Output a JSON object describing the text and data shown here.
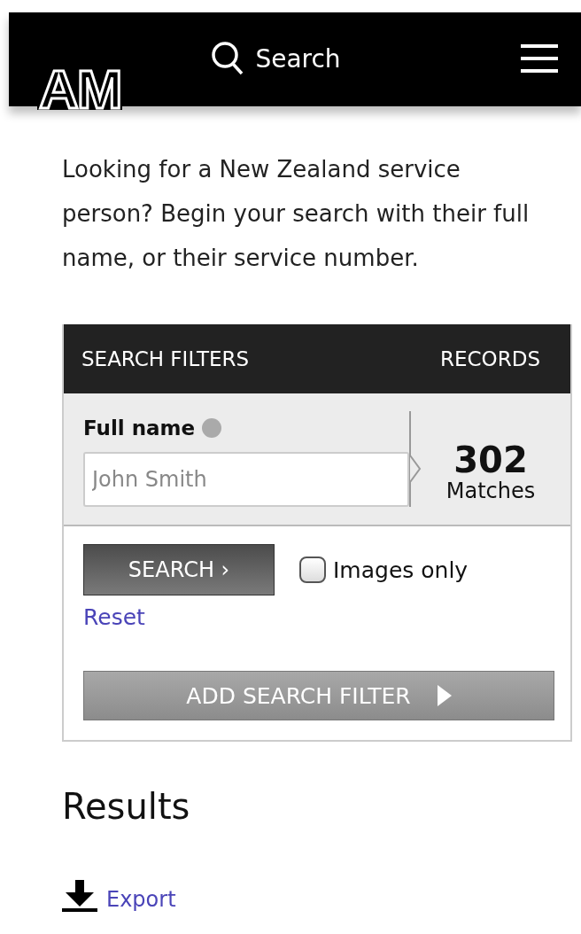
{
  "header": {
    "logo": "AM",
    "search_label": "Search"
  },
  "intro": "Looking for a New Zealand service person? Begin your search with their full name, or their service number.",
  "panel": {
    "title": "SEARCH FILTERS",
    "records_label": "RECORDS",
    "field": {
      "label": "Full name",
      "placeholder": "John Smith"
    },
    "count": "302",
    "count_label": "Matches",
    "search_button": "SEARCH ›",
    "images_only": {
      "label": "Images only",
      "checked": false
    },
    "reset": "Reset",
    "add_filter": "ADD SEARCH FILTER"
  },
  "results": {
    "heading": "Results",
    "export": "Export"
  }
}
